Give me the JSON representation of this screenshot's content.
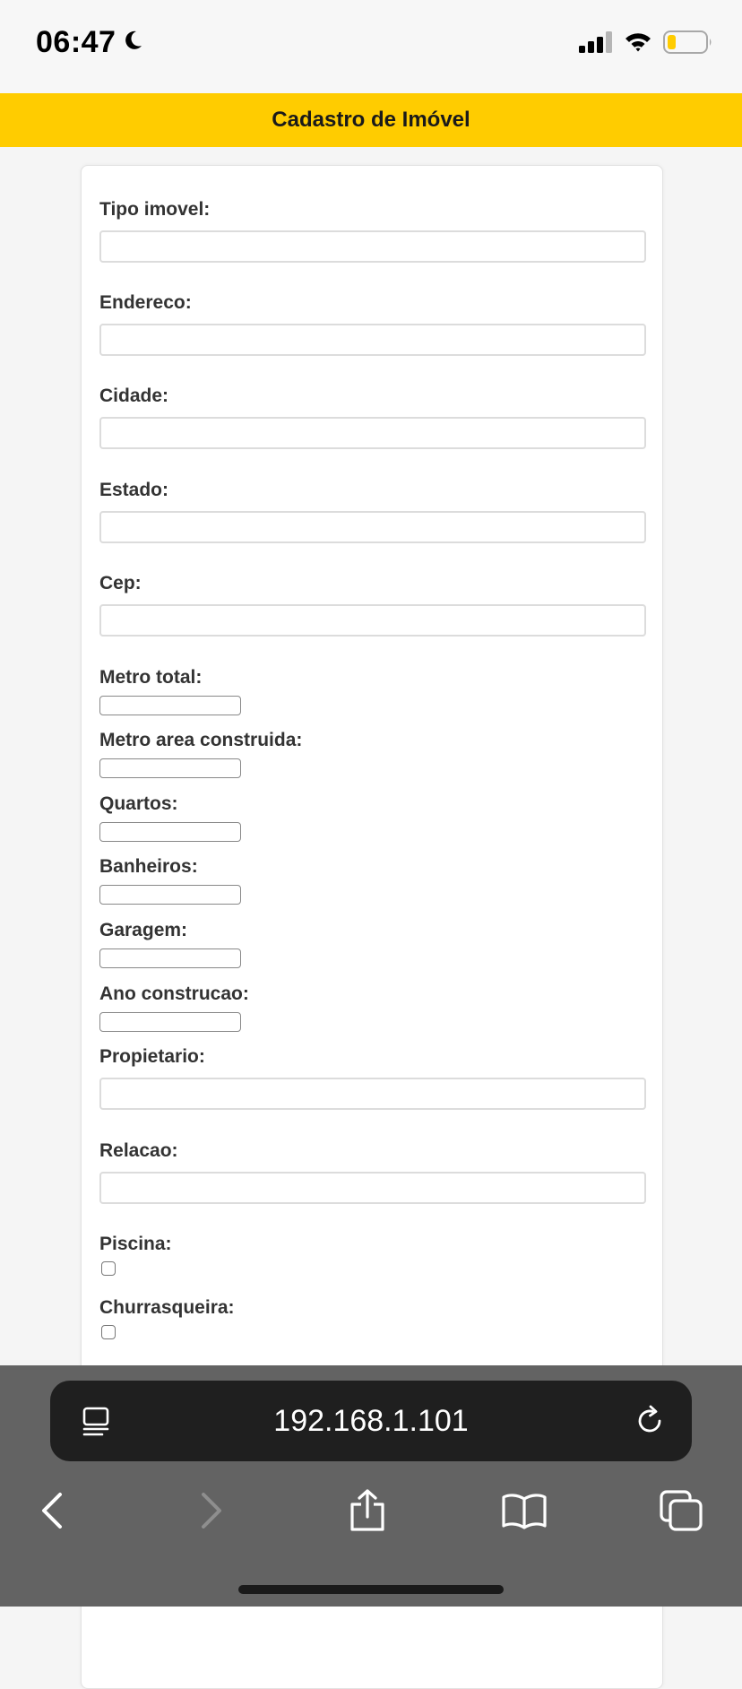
{
  "status_bar": {
    "time": "06:47",
    "moon_icon": "moon-icon",
    "signal_icon": "cellular-signal-icon",
    "wifi_icon": "wifi-icon",
    "battery_icon": "battery-icon",
    "battery_color": "#ffcc00"
  },
  "header": {
    "title": "Cadastro de Imóvel",
    "background": "#ffcc00"
  },
  "form": {
    "tipo_imovel": {
      "label": "Tipo imovel:",
      "value": ""
    },
    "endereco": {
      "label": "Endereco:",
      "value": ""
    },
    "cidade": {
      "label": "Cidade:",
      "value": ""
    },
    "estado": {
      "label": "Estado:",
      "value": ""
    },
    "cep": {
      "label": "Cep:",
      "value": ""
    },
    "metro_total": {
      "label": "Metro total:",
      "value": ""
    },
    "metro_area_construida": {
      "label": "Metro area construida:",
      "value": ""
    },
    "quartos": {
      "label": "Quartos:",
      "value": ""
    },
    "banheiros": {
      "label": "Banheiros:",
      "value": ""
    },
    "garagem": {
      "label": "Garagem:",
      "value": ""
    },
    "ano_construcao": {
      "label": "Ano construcao:",
      "value": ""
    },
    "propietario": {
      "label": "Propietario:",
      "value": ""
    },
    "relacao": {
      "label": "Relacao:",
      "value": ""
    },
    "piscina": {
      "label": "Piscina:",
      "checked": false
    },
    "churrasqueira": {
      "label": "Churrasqueira:",
      "checked": false
    }
  },
  "browser": {
    "url": "192.168.1.101",
    "icons": {
      "reader": "reader-mode-icon",
      "reload": "reload-icon",
      "back": "back-chevron-icon",
      "forward": "forward-chevron-icon",
      "share": "share-icon",
      "bookmarks": "bookmarks-book-icon",
      "tabs": "tabs-icon"
    }
  }
}
